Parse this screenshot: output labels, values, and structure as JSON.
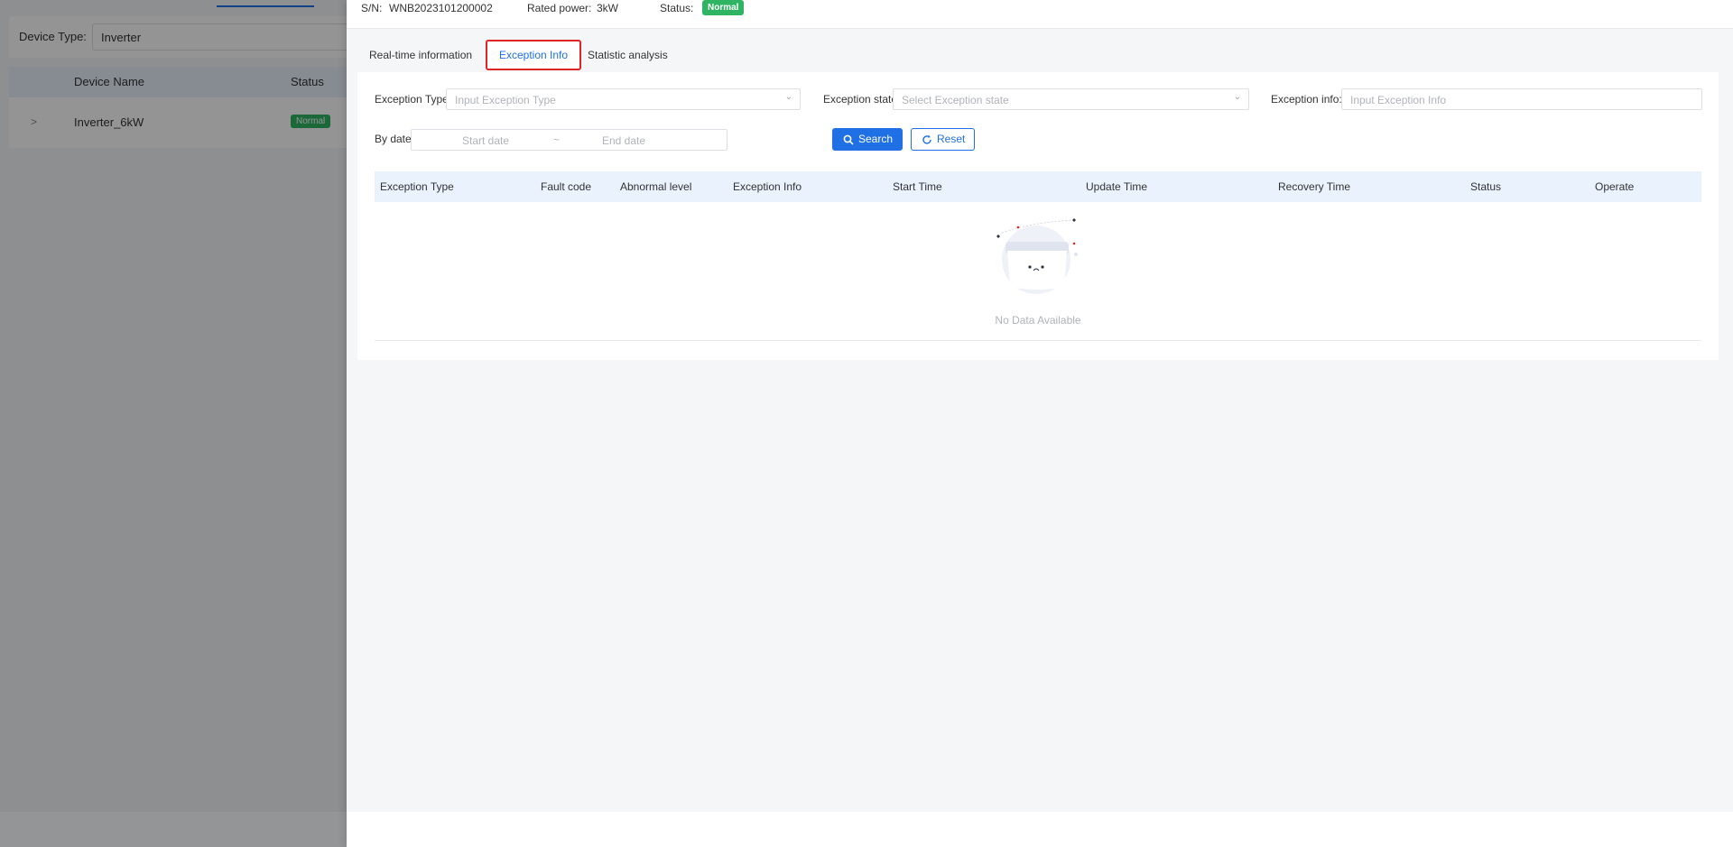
{
  "background": {
    "filter": {
      "label": "Device Type:",
      "value": "Inverter"
    },
    "table": {
      "headers": [
        "Device Name",
        "Status"
      ],
      "rows": [
        {
          "expand": ">",
          "name": "Inverter_6kW",
          "status": "Normal"
        }
      ]
    }
  },
  "header": {
    "sn_label": "S/N:",
    "sn_value": "WNB2023101200002",
    "rated_label": "Rated power:",
    "rated_value": "3kW",
    "status_label": "Status:",
    "status_value": "Normal"
  },
  "tabs": [
    {
      "label": "Real-time information"
    },
    {
      "label": "Exception Info",
      "active": true
    },
    {
      "label": "Statistic analysis"
    }
  ],
  "filters": {
    "exception_type_label": "Exception Type:",
    "exception_type_placeholder": "Input Exception Type",
    "exception_state_label": "Exception state:",
    "exception_state_placeholder": "Select Exception state",
    "exception_info_label": "Exception info:",
    "exception_info_placeholder": "Input Exception Info",
    "by_date_label": "By date:",
    "start_placeholder": "Start date",
    "date_separator": "~",
    "end_placeholder": "End date"
  },
  "buttons": {
    "search": "Search",
    "reset": "Reset"
  },
  "table": {
    "headers": [
      "Exception Type",
      "Fault code",
      "Abnormal level",
      "Exception Info",
      "Start Time",
      "Update Time",
      "Recovery Time",
      "Status",
      "Operate"
    ],
    "empty_text": "No Data Available"
  },
  "colors": {
    "primary": "#1f6fe5",
    "success": "#2fb463",
    "highlight": "#e02525"
  },
  "icons": {
    "search": "search-icon",
    "reset": "refresh-icon",
    "dropdown": "chevron-down-icon"
  }
}
